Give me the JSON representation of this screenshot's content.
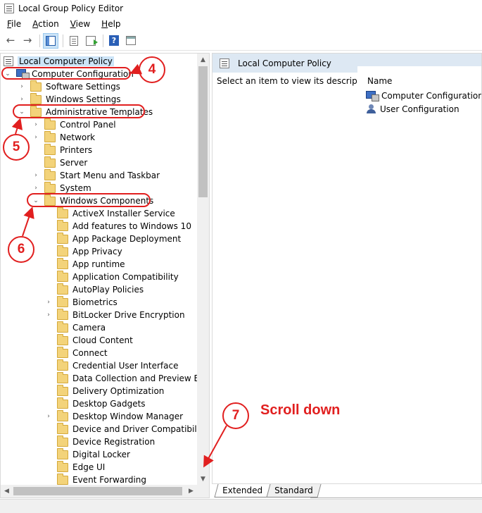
{
  "window": {
    "title": "Local Group Policy Editor"
  },
  "menu": [
    {
      "accel": "F",
      "rest": "ile"
    },
    {
      "accel": "A",
      "rest": "ction"
    },
    {
      "accel": "V",
      "rest": "iew"
    },
    {
      "accel": "H",
      "rest": "elp"
    }
  ],
  "toolbar": {
    "back_icon": "←",
    "forward_icon": "→",
    "help_label": "?"
  },
  "tree": {
    "root": "Local Computer Policy",
    "computer_configuration": "Computer Configuration",
    "software_settings": "Software Settings",
    "windows_settings": "Windows Settings",
    "administrative_templates": "Administrative Templates",
    "control_panel": "Control Panel",
    "network": "Network",
    "printers": "Printers",
    "server": "Server",
    "start_menu": "Start Menu and Taskbar",
    "system": "System",
    "windows_components": "Windows Components",
    "components": [
      "ActiveX Installer Service",
      "Add features to Windows 10",
      "App Package Deployment",
      "App Privacy",
      "App runtime",
      "Application Compatibility",
      "AutoPlay Policies",
      "Biometrics",
      "BitLocker Drive Encryption",
      "Camera",
      "Cloud Content",
      "Connect",
      "Credential User Interface",
      "Data Collection and Preview Build",
      "Delivery Optimization",
      "Desktop Gadgets",
      "Desktop Window Manager",
      "Device and Driver Compatibility",
      "Device Registration",
      "Digital Locker",
      "Edge UI",
      "Event Forwarding"
    ]
  },
  "right_pane": {
    "header": "Local Computer Policy",
    "description": "Select an item to view its description.",
    "column_name": "Name",
    "items": [
      "Computer Configuration",
      "User Configuration"
    ]
  },
  "tabs": {
    "extended": "Extended",
    "standard": "Standard"
  },
  "annotations": {
    "step4": "4",
    "step5": "5",
    "step6": "6",
    "step7": "7",
    "scroll_note": "Scroll down",
    "color": "#e11f1f"
  },
  "icons": {
    "expanded": "⌄",
    "collapsed": "›",
    "scroll_up": "▲",
    "scroll_down": "▼",
    "scroll_left": "◀",
    "scroll_right": "▶"
  }
}
